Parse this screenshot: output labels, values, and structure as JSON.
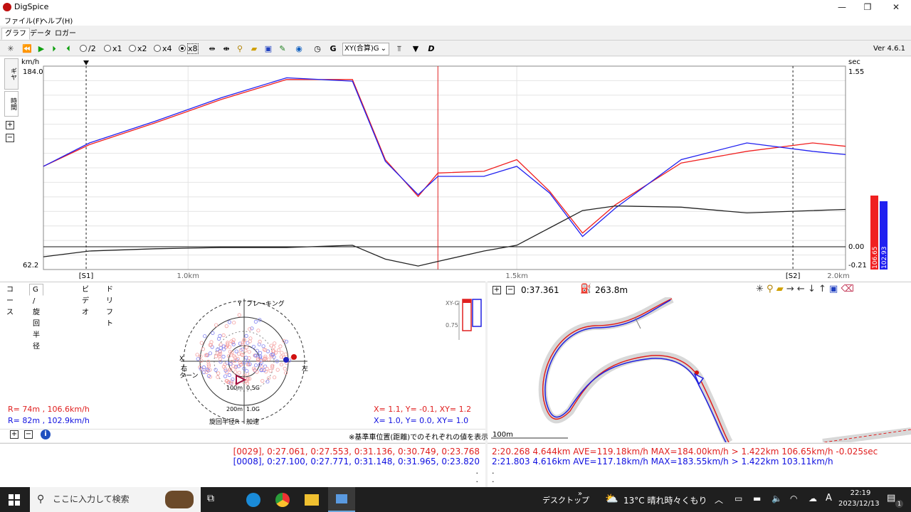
{
  "window": {
    "title": "DigSpice",
    "minimize": "—",
    "restore": "❐",
    "close": "✕"
  },
  "menu": {
    "file": "ファイル(F)",
    "help": "ヘルプ(H)"
  },
  "tabs": [
    "グラフ",
    "データ",
    "ロガー"
  ],
  "toolbar": {
    "speed_options": [
      "/2",
      "x1",
      "x2",
      "x4",
      "x8"
    ],
    "selected_speed": "x8",
    "g_label": "G",
    "graph_mode": "XY(合算)G",
    "version": "Ver 4.6.1"
  },
  "side_tabs": [
    "ギヤ",
    "時間"
  ],
  "graph": {
    "y_unit_left": "km/h",
    "y_max_left": "184.0",
    "y_min_left": "62.2",
    "y_unit_right": "sec",
    "y_max_right": "1.55",
    "y_zero_right": "0.00",
    "y_min_right": "-0.21",
    "x_ticks": [
      "1.0km",
      "1.5km",
      "2.0km"
    ],
    "sectors": [
      "[S1]",
      "[S2]"
    ],
    "bar_values": [
      "106.65",
      "102.93"
    ],
    "colors": {
      "red": "#f02020",
      "blue": "#2020f0",
      "black": "#222222"
    }
  },
  "chart_data": {
    "type": "line",
    "xlabel": "",
    "x_unit": "km",
    "xlim": [
      0.78,
      2.0
    ],
    "ylim": [
      62.2,
      184.0
    ],
    "y2lim": [
      -0.21,
      1.55
    ],
    "x": [
      0.78,
      0.85,
      0.95,
      1.05,
      1.15,
      1.25,
      1.3,
      1.35,
      1.38,
      1.45,
      1.5,
      1.55,
      1.6,
      1.65,
      1.75,
      1.85,
      1.95,
      2.0
    ],
    "series": [
      {
        "values": [
          124,
          137,
          150,
          164,
          176,
          176,
          128,
          106,
          120,
          121,
          128,
          109,
          84,
          101,
          126,
          133,
          138,
          136
        ]
      },
      {
        "values": [
          124,
          138,
          151,
          165,
          177,
          175,
          127,
          107,
          118,
          118,
          124,
          108,
          82,
          99,
          128,
          138,
          133,
          131
        ]
      },
      {
        "values": [
          -0.1,
          -0.05,
          -0.03,
          -0.02,
          -0.02,
          0.0,
          -0.12,
          -0.18,
          -0.14,
          -0.05,
          0.0,
          0.15,
          0.3,
          0.34,
          0.33,
          0.28,
          0.3,
          0.31
        ]
      }
    ]
  },
  "bottom_tabs": [
    "コース",
    "G / 旋回半径",
    "ビデオ",
    "ドリフト"
  ],
  "gg": {
    "y_label": "Y",
    "braking": "ブレーキング",
    "x_label": "X",
    "right_turn": "右",
    "turn": "ターン",
    "left_turn": "左",
    "r100": "100m",
    "g05": "0.5G",
    "r200": "200m",
    "g10": "1.0G",
    "radius_label": "旋回半径R",
    "accel": "加速",
    "xyg": "XY-G",
    "scale": "0.75",
    "r_red": "R=  74m , 106.6km/h",
    "r_blue": "R=  82m , 102.9km/h",
    "xy_red": "X=  1.1, Y= -0.1, XY= 1.2",
    "xy_blue": "X=  1.0, Y=  0.0, XY= 1.0",
    "note": "※基準車位置(距離)でのそれぞれの値を表示"
  },
  "map": {
    "time": "0:37.361",
    "distance": "263.8m",
    "scale": "100m"
  },
  "laps": {
    "red": "[0029], 0:27.061, 0:27.553, 0:31.136, 0:30.749, 0:23.768",
    "blue": "[0008], 0:27.100, 0:27.771, 0:31.148, 0:31.965, 0:23.820",
    "dot": "."
  },
  "lap_info": {
    "red": "2:20.268 4.644km AVE=119.18km/h MAX=184.00km/h > 1.422km 106.65km/h -0.025sec",
    "blue": "2:21.803 4.616km AVE=117.18km/h MAX=183.55km/h > 1.422km 103.11km/h",
    "dot": "."
  },
  "taskbar": {
    "search": "ここに入力して検索",
    "desktop": "デスクトップ",
    "weather": "13°C  晴れ時々くもり",
    "ime": "A",
    "time": "22:19",
    "date": "2023/12/13",
    "notification_count": "1"
  }
}
